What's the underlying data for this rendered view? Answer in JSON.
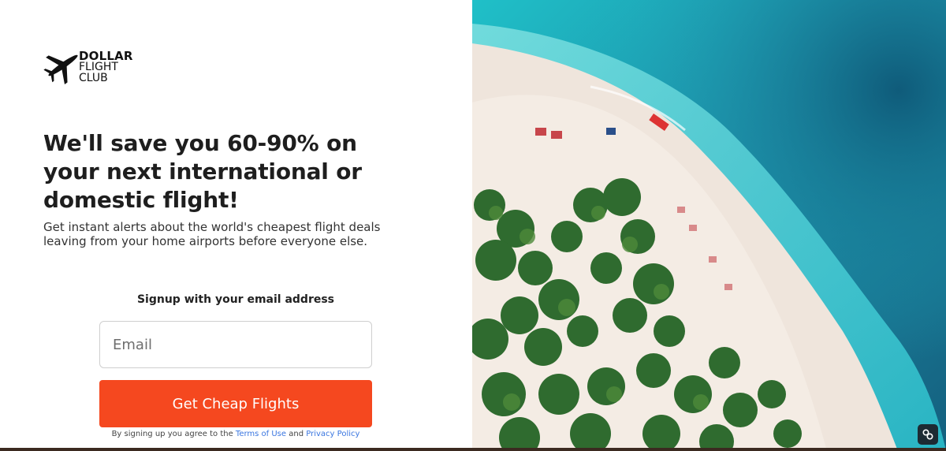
{
  "brand": {
    "line1": "DOLLAR",
    "line2": "FLIGHT",
    "line3": "CLUB",
    "icon": "airplane-icon"
  },
  "hero": {
    "headline": "We'll save you 60-90% on your next international or domestic flight!",
    "subtext": "Get instant alerts about the world's cheapest flight deals leaving from your home airports before everyone else."
  },
  "signup": {
    "label": "Signup with your email address",
    "email_placeholder": "Email",
    "email_value": "",
    "cta_label": "Get Cheap Flights",
    "terms_prefix": "By signing up you agree to the",
    "terms_link": "Terms of Use",
    "terms_and": "and",
    "privacy_link": "Privacy Policy"
  },
  "image": {
    "icon": "link-icon"
  },
  "colors": {
    "cta": "#f5481f",
    "link": "#3a76e0",
    "ocean": "#1fb5c4",
    "sand": "#f1e6dc"
  }
}
